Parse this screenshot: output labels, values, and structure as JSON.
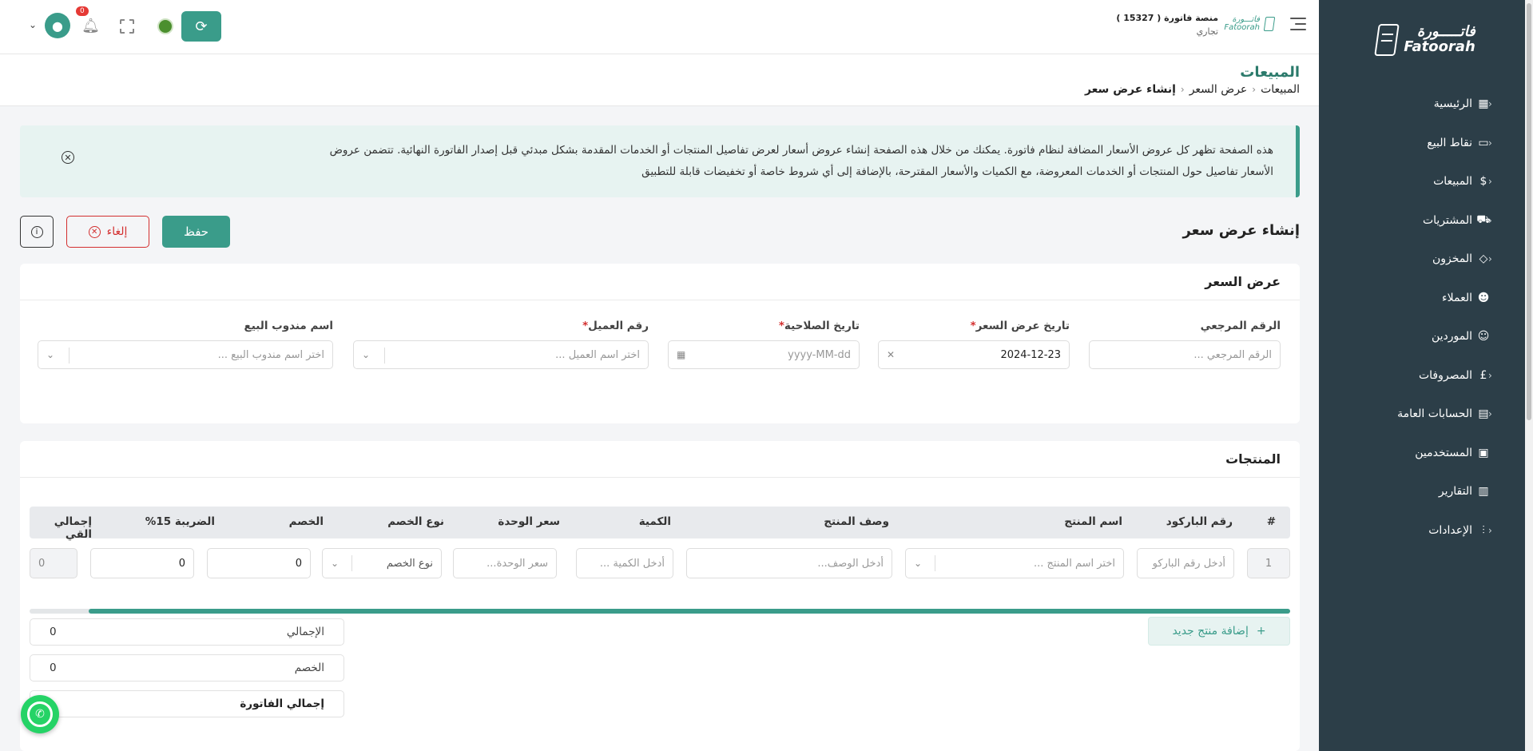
{
  "sidebar": {
    "logo_ar": "فاتـــــورة",
    "logo_en": "Fatoorah",
    "items": [
      {
        "label": "الرئيسية",
        "icon": "grid-icon"
      },
      {
        "label": "نقاط البيع",
        "icon": "monitor-icon"
      },
      {
        "label": "المبيعات",
        "icon": "dollar-icon"
      },
      {
        "label": "المشتريات",
        "icon": "cart-icon"
      },
      {
        "label": "المخزون",
        "icon": "box-icon"
      },
      {
        "label": "العملاء",
        "icon": "users-icon"
      },
      {
        "label": "الموردين",
        "icon": "suppliers-icon"
      },
      {
        "label": "المصروفات",
        "icon": "pound-icon"
      },
      {
        "label": "الحسابات العامة",
        "icon": "calculator-icon"
      },
      {
        "label": "المستخدمين",
        "icon": "user-square-icon"
      },
      {
        "label": "التقارير",
        "icon": "chart-icon"
      },
      {
        "label": "الإعدادات",
        "icon": "sliders-icon"
      }
    ]
  },
  "topbar": {
    "org_name": "منصة فاتورة",
    "org_id": "( 15327 )",
    "org_type": "تجاري",
    "brand_ar": "فاتـــورة",
    "brand_en": "Fatoorah",
    "notifications_count": "0"
  },
  "page": {
    "title": "المبيعات",
    "breadcrumb": [
      "المبيعات",
      "عرض السعر",
      "إنشاء عرض سعر"
    ]
  },
  "alert": {
    "text_line1": "هذه الصفحة تظهر كل عروض الأسعار المضافة لنظام فاتورة. يمكنك من خلال هذه الصفحة إنشاء عروض أسعار لعرض تفاصيل المنتجات أو الخدمات المقدمة بشكل مبدئي قبل إصدار الفاتورة النهائية. تتضمن عروض",
    "text_line2": "الأسعار تفاصيل حول المنتجات أو الخدمات المعروضة، مع الكميات والأسعار المقترحة، بالإضافة إلى أي شروط خاصة أو تخفيضات قابلة للتطبيق"
  },
  "form": {
    "title": "إنشاء عرض سعر",
    "save_label": "حفظ",
    "cancel_label": "إلغاء"
  },
  "quote": {
    "section_title": "عرض السعر",
    "reference": {
      "label": "الرقم المرجعي",
      "placeholder": "الرقم المرجعي ..."
    },
    "quote_date": {
      "label": "تاريخ عرض السعر",
      "required": "*",
      "value": "2024-12-23"
    },
    "expiry_date": {
      "label": "تاريخ الصلاحية",
      "required": "*",
      "placeholder": "yyyy-MM-dd"
    },
    "customer": {
      "label": "رقم العميل",
      "required": "*",
      "placeholder": "اختر اسم العميل ..."
    },
    "salesperson": {
      "label": "اسم مندوب البيع",
      "placeholder": "اختر اسم مندوب البيع ..."
    }
  },
  "products": {
    "section_title": "المنتجات",
    "columns": [
      "#",
      "رقم الباركود",
      "اسم المنتج",
      "وصف المنتج",
      "الكمية",
      "سعر الوحدة",
      "نوع الخصم",
      "الخصم",
      "الضريبة 15%",
      "إجمالي القي"
    ],
    "row": {
      "index": "1",
      "barcode_placeholder": "أدخل رقم الباركو",
      "product_placeholder": "اختر اسم المنتج ...",
      "description_placeholder": "أدخل الوصف...",
      "quantity_placeholder": "أدخل الكمية ...",
      "unit_price_placeholder": "سعر الوحدة...",
      "discount_type_placeholder": "نوع الخصم",
      "discount_value": "0",
      "tax_value": "0",
      "total_value": "0"
    },
    "add_label": "إضافة منتج جديد",
    "totals": [
      {
        "label": "الإجمالي",
        "value": "0"
      },
      {
        "label": "الخصم",
        "value": "0"
      },
      {
        "label": "إجمالي الفاتورة",
        "value": ""
      }
    ]
  }
}
